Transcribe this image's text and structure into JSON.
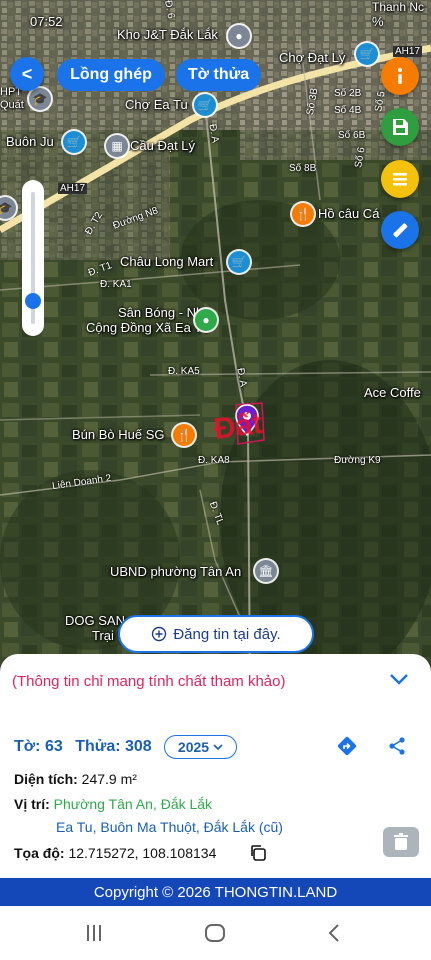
{
  "status_bar": {
    "time": "07:52",
    "battery": "%"
  },
  "toolbar": {
    "back_label": "<",
    "overlay_label": "Lồng ghép",
    "parcel_label": "Tờ thửa"
  },
  "map": {
    "places": {
      "kho_jt": "Kho J&T Đắk Lắk",
      "cho_dat_ly": "Chợ Đạt Lý",
      "cho_ea_tu": "Chợ Ea Tu",
      "cau_dat_ly": "Cầu Đạt Lý",
      "buon_ju": "Buôn Ju",
      "hpt_quat_1": "HPT",
      "hpt_quat_2": "Quát",
      "chau_long": "Châu Long Mart",
      "san_bong_1": "Sân Bóng - Nhà",
      "san_bong_2": "Cộng Đồng Xã Ea Tu",
      "ho_cau": "Hồ câu Cá",
      "ace_coffee": "Ace Coffe",
      "bun_bo": "Bún Bò Huế SG",
      "ubnd": "UBND phường Tân An",
      "dog_san_1": "DOG SAN",
      "dog_san_2": "Trại",
      "thanh_nc": "Thanh Nc",
      "parcel_marker": "Đất"
    },
    "roads": {
      "ah17_a": "AH17",
      "ah17_b": "AH17",
      "so_3b": "Số 3B",
      "so_2b": "Số 2B",
      "so_4b": "Số 4B",
      "so_6b": "Số 6B",
      "so_8b": "Số 8B",
      "so_5": "Số 5",
      "so_6": "Số 6",
      "d_a_top": "Đ. A",
      "d_a_mid": "Đ. A",
      "d_t2": "Đ. T2",
      "duong_n8": "Đường N8",
      "d_t1": "Đ. T1",
      "d_ka1": "Đ. KA1",
      "d_ka5": "Đ. KA5",
      "d_ka8": "Đ. KA8",
      "duong_k9": "Đường K9",
      "lien_doanh_2": "Liên Doanh 2",
      "d_tl": "Đ. TL",
      "d_6": "Đ. 6"
    }
  },
  "actions": {
    "info_icon": "info-icon",
    "save_icon": "save-icon",
    "list_icon": "list-icon",
    "measure_icon": "ruler-pencil-icon"
  },
  "zoom": {
    "level": 0.15
  },
  "post_button": {
    "label": "Đăng tin tại đây."
  },
  "sheet": {
    "note": "(Thông tin chỉ mang tính chất tham khảo)",
    "sheet_label": "Tờ:",
    "sheet_value": "63",
    "plot_label": "Thửa:",
    "plot_value": "308",
    "year": "2025",
    "area_label": "Diện tích:",
    "area_value": "247.9 m²",
    "location_label": "Vị trí:",
    "location_new": "Phường Tân An, Đắk Lắk",
    "location_old": "Ea Tu, Buôn Ma Thuột, Đắk Lắk (cũ)",
    "coord_label": "Tọa độ:",
    "coord_value": "12.715272, 108.108134"
  },
  "footer": {
    "copyright": "Copyright © 2026 THONGTIN.LAND"
  },
  "colors": {
    "primary": "#1a73e8",
    "info_orange": "#f57c00",
    "save_green": "#2e9e3f",
    "list_yellow": "#f4c20d",
    "note_red": "#e0245e",
    "location_green": "#2eaa4a",
    "location_blue": "#1a5fb4",
    "copyright_bg": "#1447b8"
  }
}
